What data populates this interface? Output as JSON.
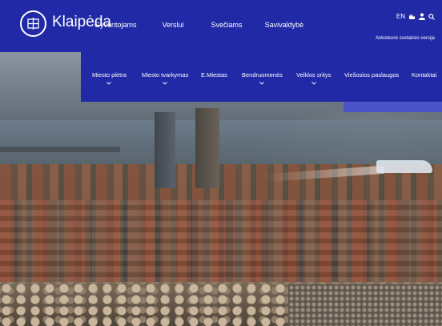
{
  "site": {
    "name": "Klaipėda"
  },
  "main_nav": [
    "Gyventojams",
    "Verslui",
    "Svečiams",
    "Savivaldybė"
  ],
  "utilities": {
    "language": "EN",
    "accessibility_link": "Ankstesnė svetainės versija"
  },
  "sub_nav": [
    {
      "label": "Miesto plėtra",
      "has_dropdown": true
    },
    {
      "label": "Miesto tvarkymas",
      "has_dropdown": true
    },
    {
      "label": "E.Miestas",
      "has_dropdown": false
    },
    {
      "label": "Bendruomenės",
      "has_dropdown": true
    },
    {
      "label": "Veiklos sritys",
      "has_dropdown": true
    },
    {
      "label": "Viešosios paslaugos",
      "has_dropdown": false
    },
    {
      "label": "Kontaktai",
      "has_dropdown": false
    }
  ],
  "colors": {
    "nav_background": "#2129a6",
    "nav_accent": "#4c55c8",
    "text": "#ffffff"
  },
  "icons": {
    "logo": "city-crest-icon",
    "sign_language": "sign-language-icon",
    "user": "user-icon",
    "search": "search-icon",
    "dropdown": "chevron-down-icon"
  }
}
